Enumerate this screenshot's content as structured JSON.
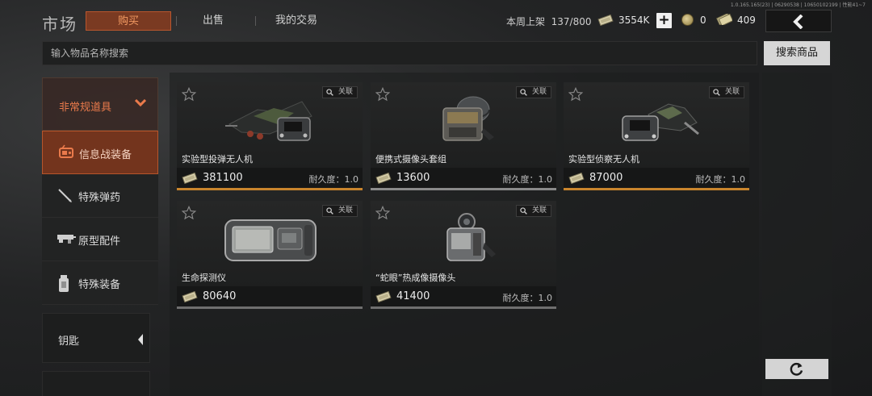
{
  "version": "1.0.165.165(23) | 06290538 | 10650102199 | 性能41~7",
  "header": {
    "title": "市场",
    "tabs": [
      {
        "label": "购买",
        "active": true
      },
      {
        "label": "出售",
        "active": false
      },
      {
        "label": "我的交易",
        "active": false
      }
    ],
    "weekly_listing_label": "本周上架",
    "weekly_listing_count": "137/800",
    "currency_main": "3554K",
    "currency_coin": "0",
    "currency_ticket": "409"
  },
  "search": {
    "placeholder": "输入物品名称搜索",
    "button_label": "搜索商品"
  },
  "sidebar": {
    "category": "非常规道具",
    "items": [
      {
        "label": "信息战装备",
        "icon": "radio-device-icon",
        "active": true
      },
      {
        "label": "特殊弹药",
        "icon": "bullet-icon",
        "active": false
      },
      {
        "label": "原型配件",
        "icon": "rifle-part-icon",
        "active": false
      },
      {
        "label": "特殊装备",
        "icon": "canister-icon",
        "active": false
      }
    ],
    "keys_label": "钥匙"
  },
  "listings": [
    {
      "name": "实验型投弹无人机",
      "price": "381100",
      "durability_label": "耐久度：",
      "durability": "1.0",
      "related_label": "关联",
      "rarity_color": "#c9852d"
    },
    {
      "name": "便携式摄像头套组",
      "price": "13600",
      "durability_label": "耐久度：",
      "durability": "1.0",
      "related_label": "关联",
      "rarity_color": "#8a8a8a"
    },
    {
      "name": "实验型侦察无人机",
      "price": "87000",
      "durability_label": "耐久度：",
      "durability": "1.0",
      "related_label": "关联",
      "rarity_color": "#c9852d"
    },
    {
      "name": "生命探测仪",
      "price": "80640",
      "durability_label": "",
      "durability": "",
      "related_label": "关联",
      "rarity_color": "#6f6f6f"
    },
    {
      "name": "“蛇眼”热成像摄像头",
      "price": "41400",
      "durability_label": "耐久度：",
      "durability": "1.0",
      "related_label": "关联",
      "rarity_color": "#6f6f6f"
    }
  ],
  "colors": {
    "accent_orange": "#ea7a4b",
    "active_tab_bg": "#7a3a22",
    "gold_rarity": "#c9852d",
    "grey_rarity": "#6f6f6f"
  }
}
